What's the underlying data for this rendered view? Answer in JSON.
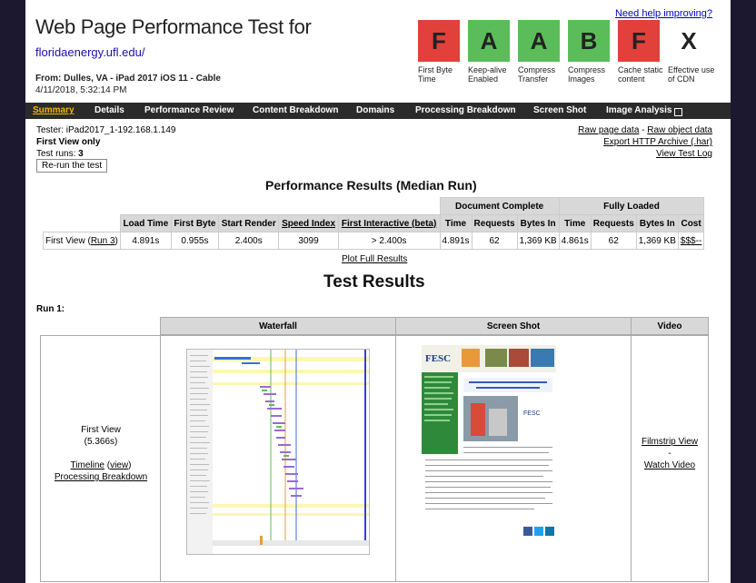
{
  "header": {
    "help_link": "Need help improving?",
    "title": "Web Page Performance Test for",
    "url": "floridaenergy.ufl.edu/",
    "from": "From: Dulles, VA - iPad 2017 iOS 11 - Cable",
    "date": "4/11/2018, 5:32:14 PM"
  },
  "grades": [
    {
      "letter": "F",
      "label": "First Byte Time",
      "color": "#e2403a"
    },
    {
      "letter": "A",
      "label": "Keep-alive Enabled",
      "color": "#5bbd5a"
    },
    {
      "letter": "A",
      "label": "Compress Transfer",
      "color": "#5bbd5a"
    },
    {
      "letter": "B",
      "label": "Compress Images",
      "color": "#5bbd5a"
    },
    {
      "letter": "F",
      "label": "Cache static content",
      "color": "#e2403a"
    },
    {
      "letter": "X",
      "label": "Effective use of CDN",
      "color": "#ffffff"
    }
  ],
  "nav": {
    "summary": "Summary",
    "details": "Details",
    "performance_review": "Performance Review",
    "content_breakdown": "Content Breakdown",
    "domains": "Domains",
    "processing_breakdown": "Processing Breakdown",
    "screen_shot": "Screen Shot",
    "image_analysis": "Image Analysis"
  },
  "info": {
    "tester": "Tester: iPad2017_1-192.168.1.149",
    "first_view_only": "First View only",
    "test_runs_label": "Test runs: ",
    "test_runs_value": "3",
    "rerun": "Re-run the test"
  },
  "raw_links": {
    "raw_page": "Raw page data",
    "sep": " - ",
    "raw_object": "Raw object data",
    "export": "Export HTTP Archive (.har)",
    "view_log": "View Test Log"
  },
  "performance": {
    "title": "Performance Results (Median Run)",
    "group_doc": "Document Complete",
    "group_full": "Fully Loaded",
    "columns": [
      "Load Time",
      "First Byte",
      "Start Render",
      "Speed Index",
      "First Interactive (beta)",
      "Time",
      "Requests",
      "Bytes In",
      "Time",
      "Requests",
      "Bytes In",
      "Cost"
    ],
    "row_label": "First View (",
    "row_run_link": "Run 3",
    "row_label_end": ")",
    "values": [
      "4.891s",
      "0.955s",
      "2.400s",
      "3099",
      "> 2.400s",
      "4.891s",
      "62",
      "1,369 KB",
      "4.861s",
      "62",
      "1,369 KB",
      "$$$--"
    ],
    "plot_link": "Plot Full Results"
  },
  "test_results": {
    "title": "Test Results",
    "run_label": "Run 1:",
    "col_waterfall": "Waterfall",
    "col_screenshot": "Screen Shot",
    "col_video": "Video",
    "first_view": "First View",
    "first_view_time": "(5.366s)",
    "timeline": "Timeline",
    "view": "view",
    "processing": "Processing Breakdown",
    "filmstrip": "Filmstrip View",
    "dash": "-",
    "watch_video": "Watch Video"
  }
}
